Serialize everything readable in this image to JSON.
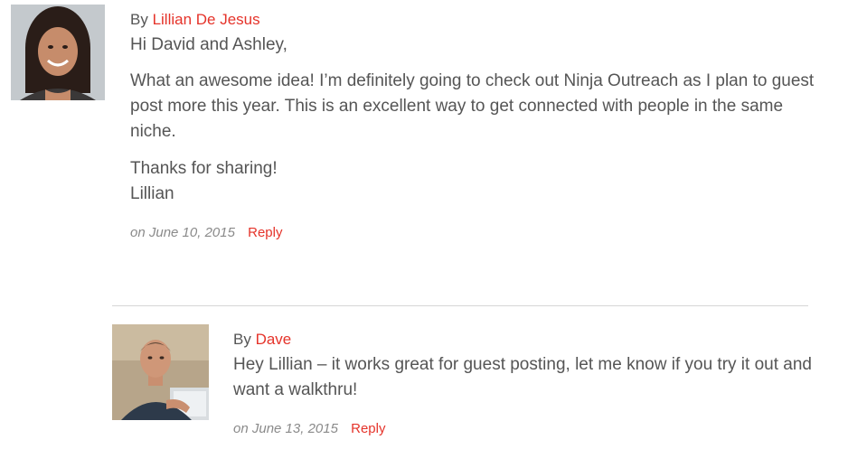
{
  "comments": [
    {
      "by_label": "By",
      "author": "Lillian De Jesus",
      "paragraphs": [
        "Hi David and Ashley,",
        "What an awesome idea! I’m definitely going to check out Ninja Outreach as I plan to guest post more this year. This is an excellent way to get connected with people in the same niche.",
        "Thanks for sharing!",
        "Lillian"
      ],
      "date": "on June 10, 2015",
      "reply_label": "Reply",
      "avatar_icon": "avatar-photo-woman"
    },
    {
      "by_label": "By",
      "author": "Dave",
      "paragraphs": [
        "Hey Lillian – it works great for guest posting, let me know if you try it out and want a walkthru!"
      ],
      "date": "on June 13, 2015",
      "reply_label": "Reply",
      "avatar_icon": "avatar-photo-man"
    }
  ],
  "colors": {
    "accent": "#e5332a",
    "text": "#555555",
    "meta": "#8a8a8a",
    "divider": "#d6d6d6"
  }
}
